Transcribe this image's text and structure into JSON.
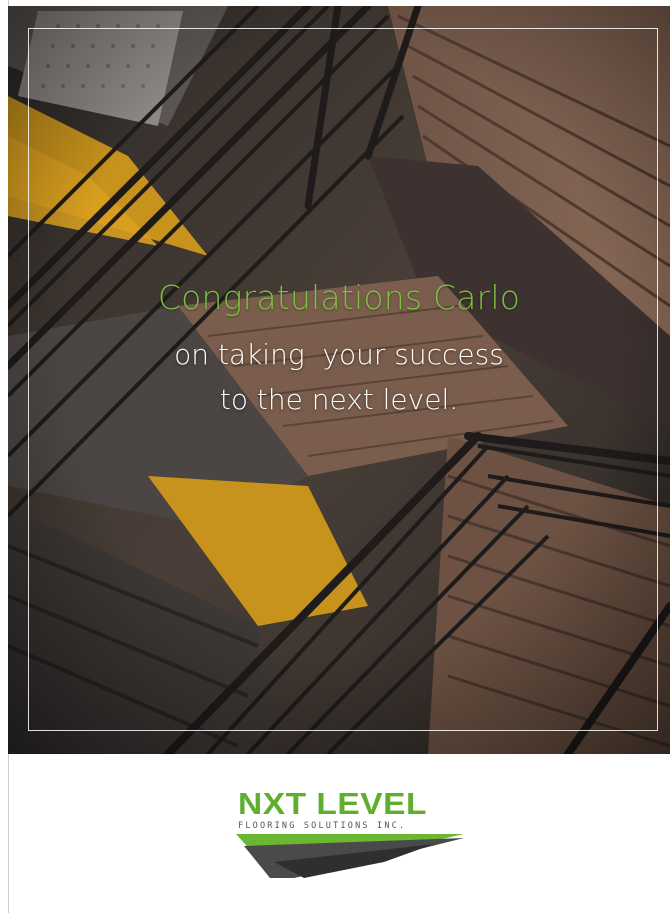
{
  "card": {
    "headline": "Congratulations Carlo",
    "line1": "on taking  your success",
    "line2": "to the next level."
  },
  "logo": {
    "name": "NXT LEVEL",
    "tagline": "FLOORING SOLUTIONS INC."
  },
  "colors": {
    "accent_green": "#7bc142",
    "logo_green": "#5fae2e",
    "logo_dark": "#4a4a4a",
    "text_white": "#ffffff"
  },
  "image": {
    "subject": "staircase-photo"
  }
}
